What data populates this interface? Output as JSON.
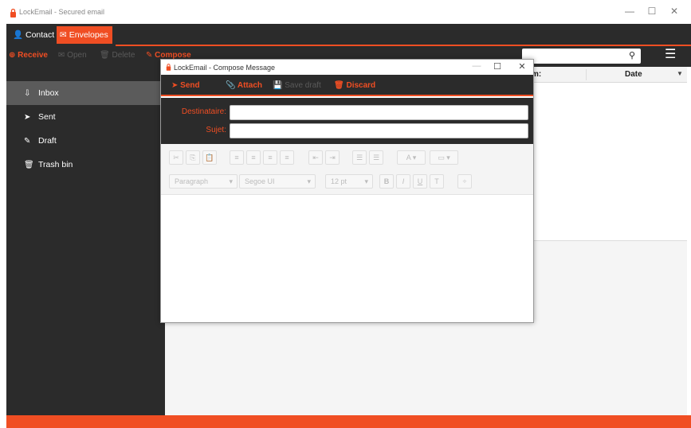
{
  "window": {
    "title": "LockEmail - Secured email",
    "minimize": "—",
    "maximize": "☐",
    "close": "✕"
  },
  "nav_tabs": {
    "contact": "Contact",
    "envelopes": "Envelopes"
  },
  "toolbar": {
    "receive": "Receive",
    "open": "Open",
    "delete": "Delete",
    "compose": "Compose",
    "sidebar_toggle": "≡",
    "menu": "☰",
    "search_icon": "🔍",
    "search_value": ""
  },
  "sidebar": {
    "items": [
      {
        "label": "Inbox",
        "icon": "inbox-icon"
      },
      {
        "label": "Sent",
        "icon": "sent-icon"
      },
      {
        "label": "Draft",
        "icon": "pencil-icon"
      },
      {
        "label": "Trash bin",
        "icon": "trash-icon"
      }
    ]
  },
  "list": {
    "from_header": "m:",
    "date_header": "Date",
    "sort_indicator": "▼"
  },
  "compose": {
    "title": "LockEmail - Compose Message",
    "minimize": "—",
    "maximize": "☐",
    "close": "✕",
    "toolbar": {
      "send": "Send",
      "attach": "Attach",
      "save_draft": "Save draft",
      "discard": "Discard"
    },
    "fields": {
      "recipient_label": "Destinataire:",
      "recipient_value": "",
      "subject_label": "Sujet:",
      "subject_value": ""
    },
    "editor": {
      "paragraph": "Paragraph",
      "font": "Segoe UI",
      "size": "12 pt",
      "bold": "B",
      "italic": "I",
      "underline": "U",
      "strike": "T"
    }
  },
  "colors": {
    "accent": "#f04e23",
    "dark": "#2b2b2b",
    "sidebar_active": "#5b5b5b"
  }
}
